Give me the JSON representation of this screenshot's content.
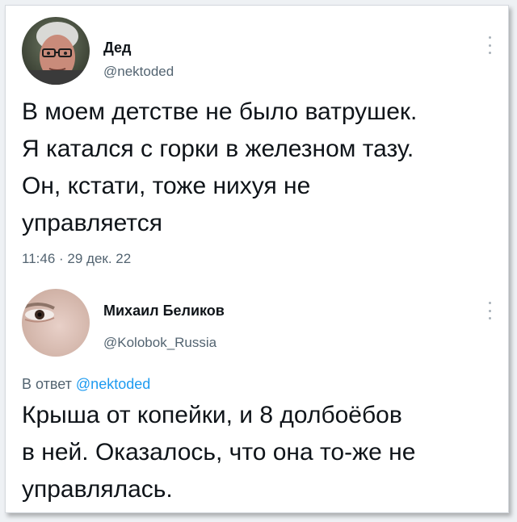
{
  "tweets": [
    {
      "author_name": "Дед",
      "author_handle": "@nektoded",
      "text": "В моем детстве не было ватрушек.\nЯ катался с горки в железном тазу.\nОн, кстати, тоже нихуя не\nуправляется",
      "timestamp": "11:46 · 29 дек. 22",
      "avatar_icon": "elderly-man-photo"
    },
    {
      "author_name": "Михаил Беликов",
      "author_handle": "@Kolobok_Russia",
      "reply_prefix": "В ответ",
      "reply_to": "@nektoded",
      "text": "Крыша от копейки, и 8 долбоёбов\nв ней. Оказалось, что она то-же не\nуправлялась.",
      "avatar_icon": "closeup-eye-photo"
    }
  ],
  "more_icon": "vertical-ellipsis-icon",
  "colors": {
    "text": "#0f1419",
    "secondary": "#536471",
    "link": "#1d9bf0",
    "background": "#eef1f4",
    "card": "#ffffff"
  }
}
